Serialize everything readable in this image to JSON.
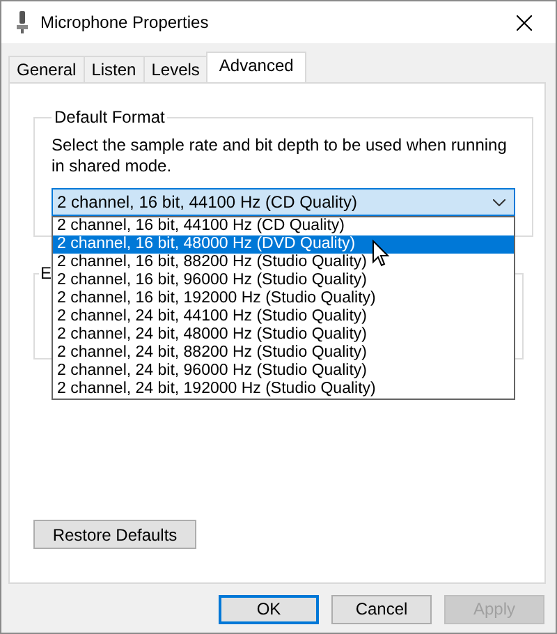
{
  "window": {
    "title": "Microphone Properties"
  },
  "tabs": [
    {
      "label": "General",
      "selected": false
    },
    {
      "label": "Listen",
      "selected": false
    },
    {
      "label": "Levels",
      "selected": false
    },
    {
      "label": "Advanced",
      "selected": true
    }
  ],
  "default_format": {
    "title": "Default Format",
    "description": "Select the sample rate and bit depth to be used when running in shared mode.",
    "dropdown": {
      "value": "2 channel, 16 bit, 44100 Hz (CD Quality)",
      "expanded": true
    },
    "options": [
      {
        "label": "2 channel, 16 bit, 44100 Hz (CD Quality)",
        "selected": false
      },
      {
        "label": "2 channel, 16 bit, 48000 Hz (DVD Quality)",
        "selected": true
      },
      {
        "label": "2 channel, 16 bit, 88200 Hz (Studio Quality)",
        "selected": false
      },
      {
        "label": "2 channel, 16 bit, 96000 Hz (Studio Quality)",
        "selected": false
      },
      {
        "label": "2 channel, 16 bit, 192000 Hz (Studio Quality)",
        "selected": false
      },
      {
        "label": "2 channel, 24 bit, 44100 Hz (Studio Quality)",
        "selected": false
      },
      {
        "label": "2 channel, 24 bit, 48000 Hz (Studio Quality)",
        "selected": false
      },
      {
        "label": "2 channel, 24 bit, 88200 Hz (Studio Quality)",
        "selected": false
      },
      {
        "label": "2 channel, 24 bit, 96000 Hz (Studio Quality)",
        "selected": false
      },
      {
        "label": "2 channel, 24 bit, 192000 Hz (Studio Quality)",
        "selected": false
      }
    ]
  },
  "exclusive_mode": {
    "title": "E"
  },
  "restore_button": "Restore Defaults",
  "buttons": [
    {
      "label": "OK",
      "kind": "default"
    },
    {
      "label": "Cancel",
      "kind": "normal"
    },
    {
      "label": "Apply",
      "kind": "disabled"
    }
  ]
}
